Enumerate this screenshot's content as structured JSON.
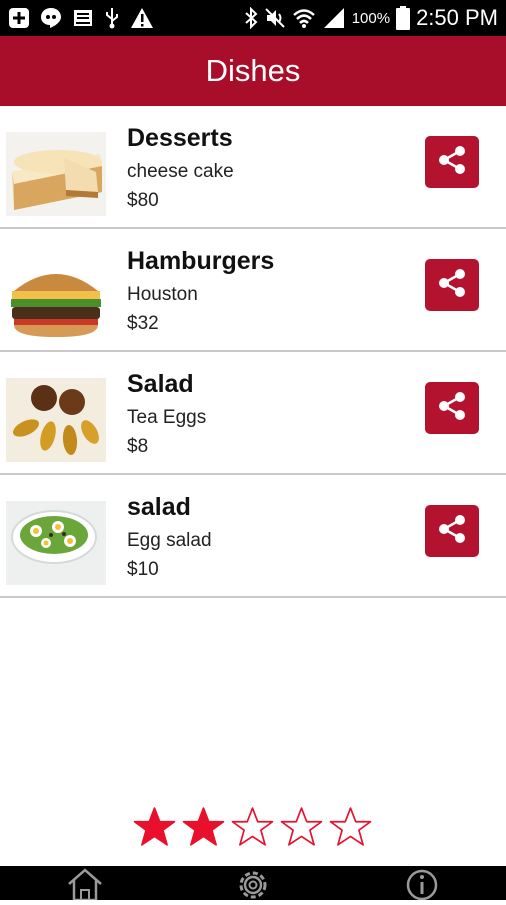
{
  "status_bar": {
    "battery": "100%",
    "time": "2:50 PM"
  },
  "app_bar": {
    "title": "Dishes"
  },
  "dishes": [
    {
      "name": "Desserts",
      "description": "cheese cake",
      "price": "$80"
    },
    {
      "name": "Hamburgers",
      "description": "Houston",
      "price": "$32"
    },
    {
      "name": "Salad",
      "description": "Tea Eggs",
      "price": "$8"
    },
    {
      "name": "salad",
      "description": "Egg salad",
      "price": "$10"
    }
  ],
  "rating": {
    "value": 2,
    "max": 5,
    "color": "#e8102c"
  },
  "theme": {
    "primary": "#a80d2a",
    "share_button": "#b4132f"
  },
  "bottom_nav": {
    "items": [
      "home-icon",
      "gear-icon",
      "info-icon"
    ]
  }
}
